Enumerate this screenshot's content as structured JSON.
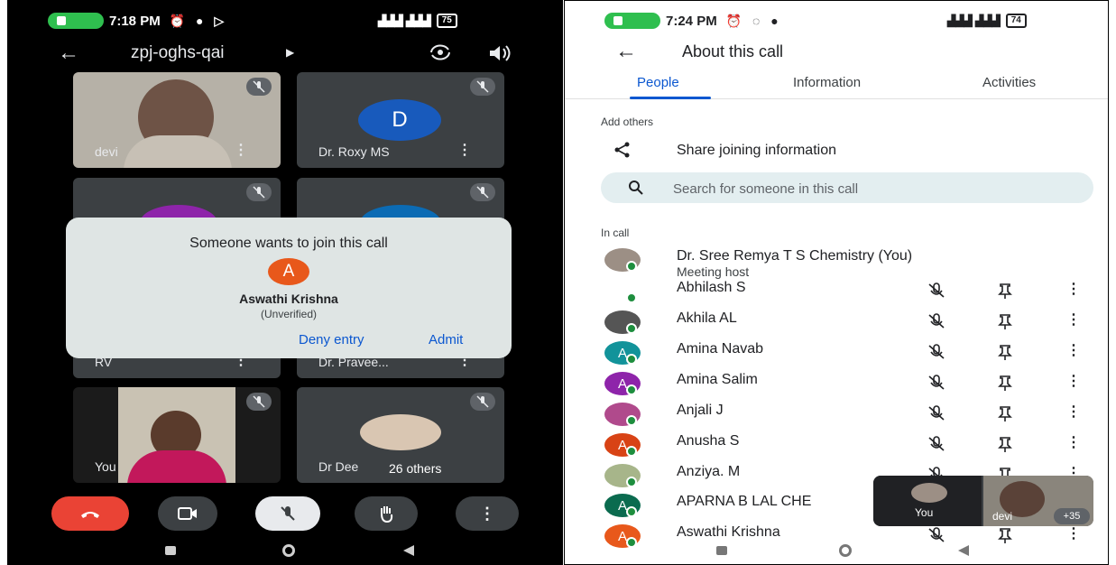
{
  "left": {
    "status": {
      "time": "7:18 PM",
      "battery": "75"
    },
    "meeting_code": "zpj-oghs-qai",
    "tiles": [
      {
        "name": "devi"
      },
      {
        "name": "Dr. Roxy MS",
        "initial": "D"
      },
      {
        "name": "RV"
      },
      {
        "name": "Dr. Pravee..."
      },
      {
        "name": "You"
      },
      {
        "name": "Dr Dee",
        "others": "26 others"
      }
    ],
    "join_dialog": {
      "title": "Someone wants to join this call",
      "initial": "A",
      "person": "Aswathi Krishna",
      "status": "(Unverified)",
      "deny_label": "Deny entry",
      "admit_label": "Admit"
    },
    "colors": {
      "end_call": "#ea4335",
      "avatar_d": "#185abc",
      "avatar_a": "#e8581b"
    }
  },
  "right": {
    "status": {
      "time": "7:24 PM",
      "battery": "74"
    },
    "header_title": "About this call",
    "tabs": [
      "People",
      "Information",
      "Activities"
    ],
    "add_others_label": "Add others",
    "share_label": "Share joining information",
    "search_placeholder": "Search for someone in this call",
    "in_call_label": "In call",
    "people": [
      {
        "name": "Dr. Sree Remya T S Chemistry (You)",
        "sub": "Meeting host",
        "initial": "",
        "color": "#9c8f85"
      },
      {
        "name": "Abhilash S",
        "initial": "",
        "color": "#ffffff"
      },
      {
        "name": "Akhila AL",
        "initial": "",
        "color": "#555555"
      },
      {
        "name": "Amina Navab",
        "initial": "A",
        "color": "#12939a"
      },
      {
        "name": "Amina Salim",
        "initial": "A",
        "color": "#8e24aa"
      },
      {
        "name": "Anjali J",
        "initial": "",
        "color": "#b04a8c"
      },
      {
        "name": "Anusha S",
        "initial": "A",
        "color": "#d84315"
      },
      {
        "name": "Anziya. M",
        "initial": "",
        "color": "#a7b58a"
      },
      {
        "name": "APARNA B LAL CHE",
        "initial": "A",
        "color": "#0b6b4f"
      },
      {
        "name": "Aswathi Krishna",
        "initial": "A",
        "color": "#e8581b"
      }
    ],
    "pip": {
      "you_label": "You",
      "devi_label": "devi",
      "more": "+35"
    }
  }
}
